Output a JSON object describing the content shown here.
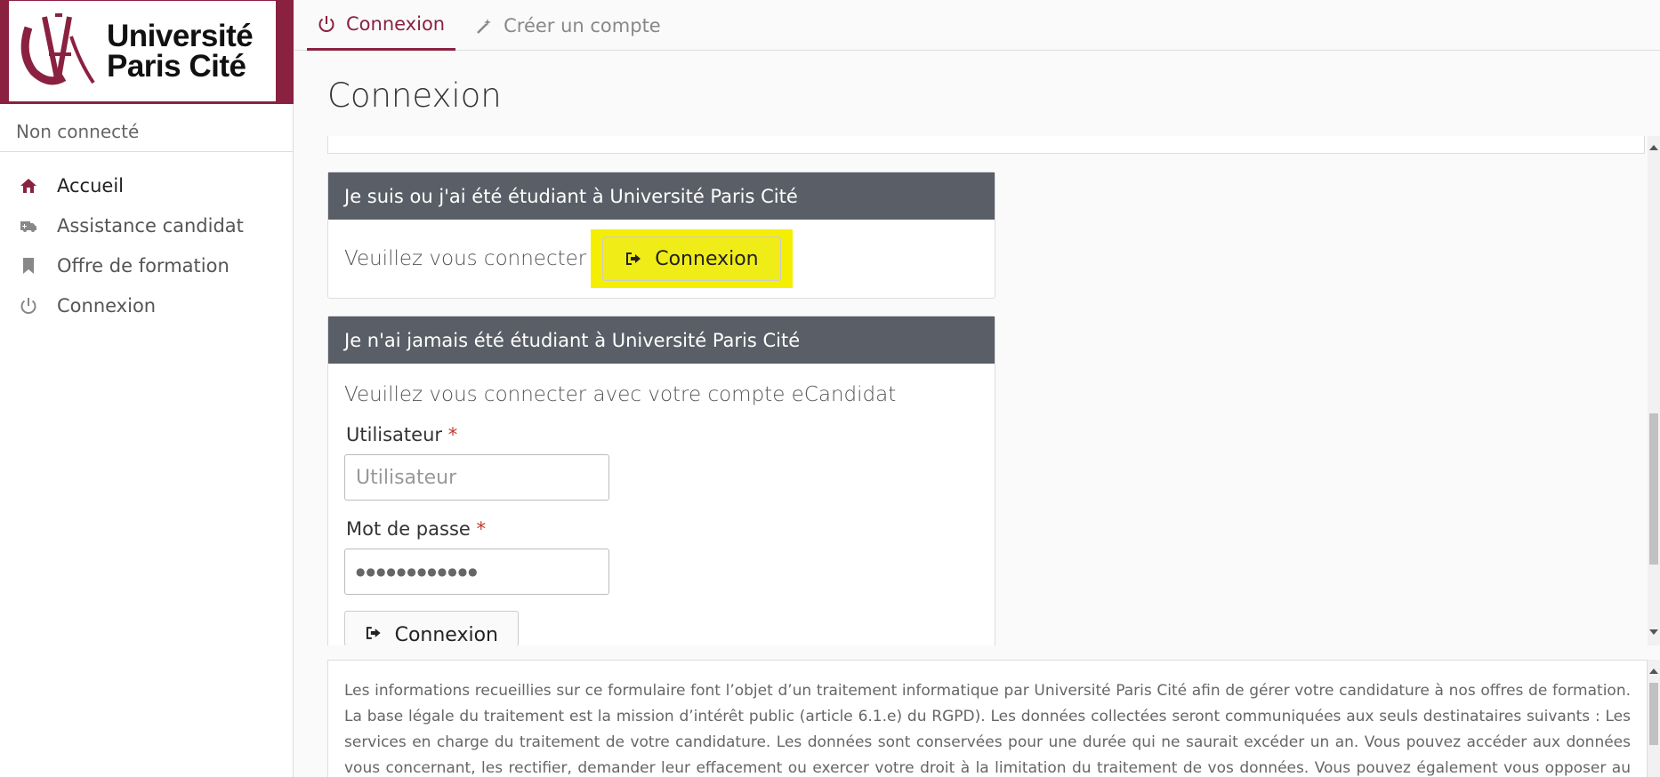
{
  "brand": {
    "line1": "Université",
    "line2": "Paris Cité",
    "accent": "#8a2140"
  },
  "sidebar": {
    "status": "Non connecté",
    "items": [
      {
        "label": "Accueil",
        "icon": "home-icon"
      },
      {
        "label": "Assistance candidat",
        "icon": "ambulance-icon"
      },
      {
        "label": "Offre de formation",
        "icon": "bookmark-icon"
      },
      {
        "label": "Connexion",
        "icon": "power-icon"
      }
    ]
  },
  "tabs": [
    {
      "label": "Connexion",
      "icon": "power-icon"
    },
    {
      "label": "Créer un compte",
      "icon": "magic-wand-icon"
    }
  ],
  "page": {
    "title": "Connexion"
  },
  "panel_student": {
    "header": "Je suis ou j'ai été étudiant à Université Paris Cité",
    "text": "Veuillez vous connecter",
    "button": "Connexion"
  },
  "panel_new": {
    "header": "Je n'ai jamais été étudiant à Université Paris Cité",
    "text": "Veuillez vous connecter avec votre compte eCandidat",
    "user_label": "Utilisateur",
    "user_placeholder": "Utilisateur",
    "password_label": "Mot de passe",
    "password_value": "●●●●●●●●●●●●",
    "required_mark": "*",
    "button": "Connexion"
  },
  "notice": {
    "text": "Les informations recueillies sur ce formulaire font l’objet d’un traitement informatique par Université Paris Cité afin de gérer votre candidature à nos offres de formation. La base légale du traitement est la mission d’intérêt public (article 6.1.e) du RGPD). Les données collectées seront communiquées aux seuls destinataires suivants : Les services en charge du traitement de votre candidature. Les données sont conservées pour une durée qui ne saurait excéder un an. Vous pouvez accéder aux données vous concernant, les rectifier, demander leur effacement ou exercer votre droit à la limitation du traitement de vos données. Vous pouvez également vous opposer au traitement de vos données. Pour exercer"
  }
}
